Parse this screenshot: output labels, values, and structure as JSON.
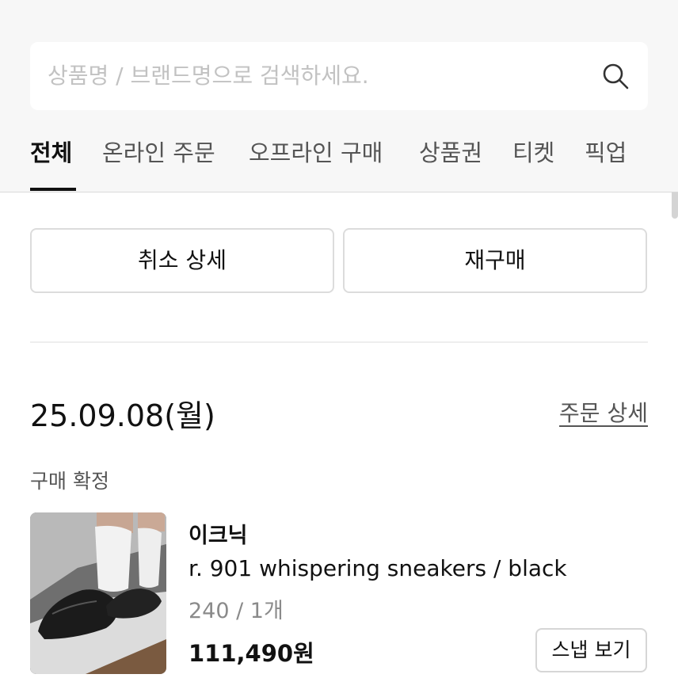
{
  "search": {
    "placeholder": "상품명 / 브랜드명으로 검색하세요.",
    "icon": "search-icon"
  },
  "tabs": [
    {
      "label": "전체",
      "active": true
    },
    {
      "label": "온라인 주문",
      "active": false
    },
    {
      "label": "오프라인 구매",
      "active": false
    },
    {
      "label": "상품권",
      "active": false
    },
    {
      "label": "티켓",
      "active": false
    },
    {
      "label": "픽업",
      "active": false
    }
  ],
  "actions": {
    "cancel_detail": "취소 상세",
    "rebuy": "재구매"
  },
  "order": {
    "date": "25.09.08(월)",
    "detail_link": "주문 상세",
    "status": "구매 확정",
    "item": {
      "brand": "이크닉",
      "name": "r. 901 whispering sneakers / black",
      "option": "240 / 1개",
      "price": "111,490원",
      "snap_button": "스냅 보기"
    }
  },
  "colors": {
    "text_primary": "#111111",
    "text_secondary": "#555555",
    "text_muted": "#8a8a8a",
    "placeholder": "#c2c2c2",
    "border": "#dcdcdc",
    "header_bg": "#f7f7f7"
  }
}
